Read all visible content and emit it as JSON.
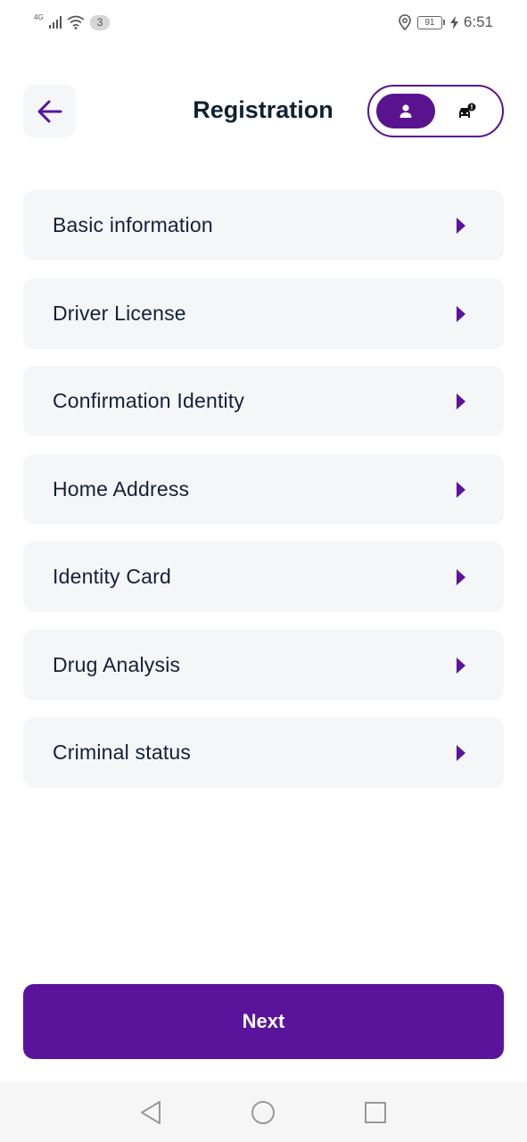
{
  "status_bar": {
    "network": "4G",
    "notification_count": "3",
    "battery": "91",
    "time": "6:51"
  },
  "header": {
    "title": "Registration",
    "back_icon": "arrow-left-icon",
    "role_toggle": {
      "selected": "passenger",
      "options": [
        {
          "id": "passenger",
          "icon": "person-icon"
        },
        {
          "id": "driver",
          "icon": "car-alert-icon"
        }
      ]
    }
  },
  "menu": {
    "items": [
      {
        "label": "Basic information"
      },
      {
        "label": "Driver License"
      },
      {
        "label": "Confirmation Identity"
      },
      {
        "label": "Home Address"
      },
      {
        "label": "Identity Card"
      },
      {
        "label": "Drug Analysis"
      },
      {
        "label": "Criminal status"
      }
    ],
    "arrow_icon": "caret-right-icon"
  },
  "footer": {
    "next_label": "Next"
  },
  "colors": {
    "accent": "#5a139b",
    "card_background": "#f5f6f8",
    "title_text": "#0f2233"
  }
}
